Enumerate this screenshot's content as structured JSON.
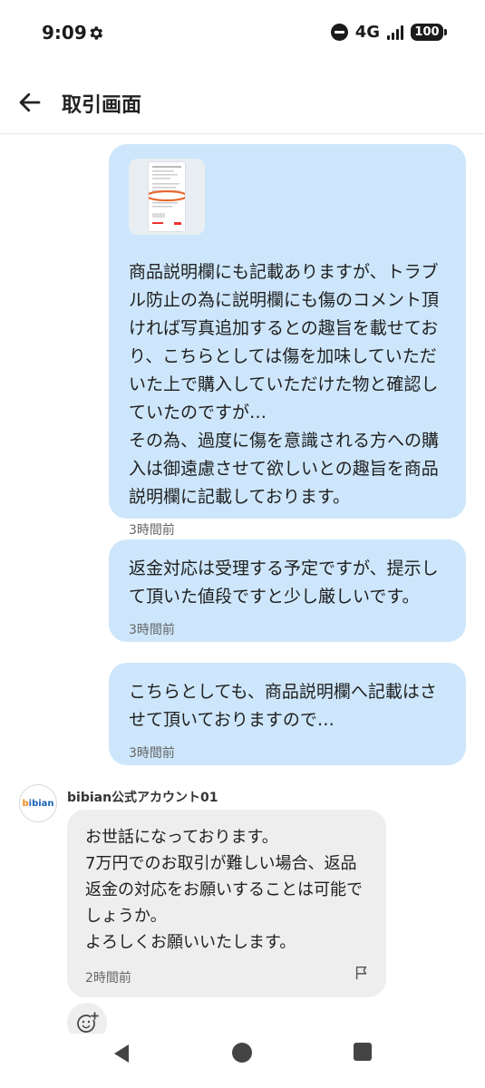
{
  "status_bar": {
    "time": "9:09",
    "network": "4G",
    "battery": "100"
  },
  "header": {
    "title": "取引画面"
  },
  "messages_out": [
    {
      "has_image": true,
      "text": "商品説明欄にも記載ありますが、トラブル防止の為に説明欄にも傷のコメント頂ければ写真追加するとの趣旨を載せており、こちらとしては傷を加味していただいた上で購入していただけた物と確認していたのですが…\nその為、過度に傷を意識される方への購入は御遠慮させて欲しいとの趣旨を商品説明欄に記載しております。",
      "time": "3時間前"
    },
    {
      "text": "返金対応は受理する予定ですが、提示して頂いた値段ですと少し厳しいです。",
      "time": "3時間前"
    },
    {
      "text": "こちらとしても、商品説明欄へ記載はさせて頂いておりますので…",
      "time": "3時間前"
    }
  ],
  "message_in": {
    "sender": "bibian公式アカウント01",
    "avatar_logo": "bibian",
    "text": "お世話になっております。\n7万円でのお取引が難しい場合、返品返金の対応をお願いすることは可能でしょうか。\nよろしくお願いいたします。",
    "time": "2時間前"
  },
  "colors": {
    "outgoing_bubble": "#cde6fb",
    "incoming_bubble": "#eeeeee",
    "thumb_accent": "#e8692f"
  },
  "icons": {
    "back": "arrow-left-icon",
    "flag": "flag-icon",
    "reaction": "add-reaction-icon"
  }
}
